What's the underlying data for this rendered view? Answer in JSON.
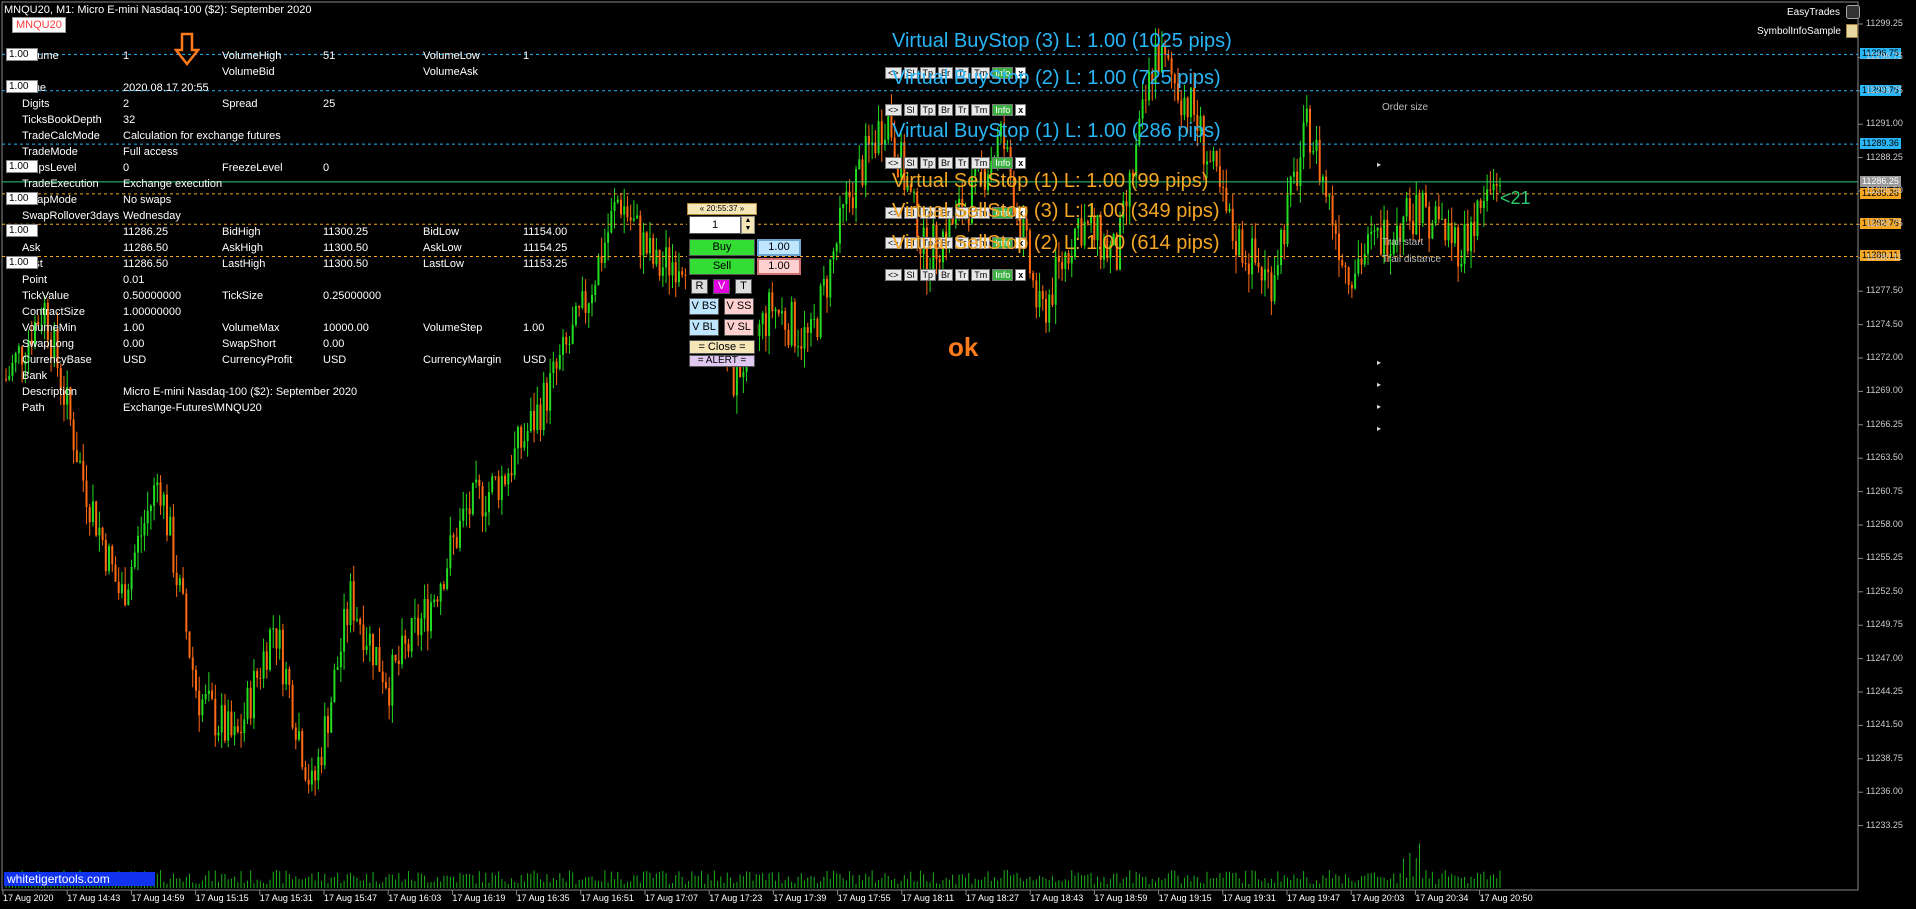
{
  "window": {
    "title": "MNQU20, M1:  Micro E-mini Nasdaq-100 ($2): September 2020",
    "symbol_badge": "MNQU20",
    "top_right_label1": "EasyTrades",
    "top_right_label2": "SymbolInfoSample"
  },
  "lot_default": "1.00",
  "info_rows": [
    {
      "c1": "Volume",
      "v1": "1",
      "c2": "VolumeHigh",
      "v2": "51",
      "c3": "VolumeLow",
      "v3": "1"
    },
    {
      "c1": "",
      "v1": "",
      "c2": "VolumeBid",
      "v2": "",
      "c3": "VolumeAsk",
      "v3": ""
    },
    {
      "c1": "Time",
      "v1": "2020.08.17 20:55",
      "c2": "",
      "v2": "",
      "c3": "",
      "v3": ""
    },
    {
      "c1": "Digits",
      "v1": "2",
      "c2": "Spread",
      "v2": "25",
      "c3": "",
      "v3": ""
    },
    {
      "c1": "TicksBookDepth",
      "v1": "32",
      "c2": "",
      "v2": "",
      "c3": "",
      "v3": ""
    },
    {
      "c1": "TradeCalcMode",
      "v1": "Calculation for exchange futures",
      "c2": "",
      "v2": "",
      "c3": "",
      "v3": ""
    },
    {
      "c1": "TradeMode",
      "v1": "Full access",
      "c2": "",
      "v2": "",
      "c3": "",
      "v3": ""
    },
    {
      "c1": "StopsLevel",
      "v1": "0",
      "c2": "FreezeLevel",
      "v2": "0",
      "c3": "",
      "v3": ""
    },
    {
      "c1": "TradeExecution",
      "v1": "Exchange execution",
      "c2": "",
      "v2": "",
      "c3": "",
      "v3": ""
    },
    {
      "c1": "SwapMode",
      "v1": "No swaps",
      "c2": "",
      "v2": "",
      "c3": "",
      "v3": ""
    },
    {
      "c1": "SwapRollover3days",
      "v1": "Wednesday",
      "c2": "",
      "v2": "",
      "c3": "",
      "v3": ""
    },
    {
      "c1": "Bid",
      "v1": "11286.25",
      "c2": "BidHigh",
      "v2": "11300.25",
      "c3": "BidLow",
      "v3": "11154.00"
    },
    {
      "c1": "Ask",
      "v1": "11286.50",
      "c2": "AskHigh",
      "v2": "11300.50",
      "c3": "AskLow",
      "v3": "11154.25"
    },
    {
      "c1": "Last",
      "v1": "11286.50",
      "c2": "LastHigh",
      "v2": "11300.50",
      "c3": "LastLow",
      "v3": "11153.25"
    },
    {
      "c1": "Point",
      "v1": "0.01",
      "c2": "",
      "v2": "",
      "c3": "",
      "v3": ""
    },
    {
      "c1": "TickValue",
      "v1": "0.50000000",
      "c2": "TickSize",
      "v2": "0.25000000",
      "c3": "",
      "v3": ""
    },
    {
      "c1": "ContractSize",
      "v1": "1.00000000",
      "c2": "",
      "v2": "",
      "c3": "",
      "v3": ""
    },
    {
      "c1": "VolumeMin",
      "v1": "1.00",
      "c2": "VolumeMax",
      "v2": "10000.00",
      "c3": "VolumeStep",
      "v3": "1.00"
    },
    {
      "c1": "SwapLong",
      "v1": "0.00",
      "c2": "SwapShort",
      "v2": "0.00",
      "c3": "",
      "v3": ""
    },
    {
      "c1": "CurrencyBase",
      "v1": "USD",
      "c2": "CurrencyProfit",
      "v2": "USD",
      "c3": "CurrencyMargin",
      "v3": "USD"
    },
    {
      "c1": "Bank",
      "v1": "",
      "c2": "",
      "v2": "",
      "c3": "",
      "v3": ""
    },
    {
      "c1": "Description",
      "v1": "Micro E-mini Nasdaq-100 ($2): September 2020",
      "c2": "",
      "v2": "",
      "c3": "",
      "v3": ""
    },
    {
      "c1": "Path",
      "v1": "Exchange-Futures\\MNQU20",
      "c2": "",
      "v2": "",
      "c3": "",
      "v3": ""
    }
  ],
  "orders": [
    {
      "label": "Virtual BuyStop (3) L: 1.00 (1025 pips)",
      "kind": "buy",
      "price": 11296.75,
      "tag": "11296.75"
    },
    {
      "label": "Virtual BuyStop (2) L: 1.00 (725 pips)",
      "kind": "buy",
      "price": 11293.75,
      "tag": "11293.75"
    },
    {
      "label": "Virtual BuyStop (1) L: 1.00 (286 pips)",
      "kind": "buy",
      "price": 11289.36,
      "tag": "11289.36"
    },
    {
      "label": "Virtual SellStop (1) L: 1.00 (99 pips)",
      "kind": "sell",
      "price": 11285.26,
      "tag": "11285.26"
    },
    {
      "label": "Virtual SellStop (3) L: 1.00 (349 pips)",
      "kind": "sell",
      "price": 11282.76,
      "tag": "11282.76"
    },
    {
      "label": "Virtual SellStop (2) L: 1.00 (614 pips)",
      "kind": "sell",
      "price": 11280.11,
      "tag": "11280.11"
    }
  ],
  "order_buttons": [
    "<>",
    "Sl",
    "Tp",
    "Br",
    "Tr",
    "Tm",
    "Info",
    "x"
  ],
  "panel": {
    "title": "« 20:55:37 »",
    "qty": "1",
    "buy": "Buy",
    "sell": "Sell",
    "buy_lot": "1.00",
    "sell_lot": "1.00",
    "r": "R",
    "v": "V",
    "t": "T",
    "vbs": "V BS",
    "vss": "V SS",
    "vbl": "V BL",
    "vsl": "V SL",
    "close": "= Close =",
    "alert": "= ALERT ="
  },
  "annotations": {
    "ok": "ok",
    "counter": "<21",
    "order_size": "Order size",
    "trail_start": "Trail start",
    "trail_distance": "Trail distance",
    "watermark": "whitetigertools.com"
  },
  "current_price": {
    "price": 11286.25,
    "tag": "11286.25"
  },
  "price_axis": [
    "11299.25",
    "11296.75",
    "11293.75",
    "11291.00",
    "11288.25",
    "11285.50",
    "11282.75",
    "11280.11",
    "11277.50",
    "11274.50",
    "11272.00",
    "11269.00",
    "11266.25",
    "11263.50",
    "11260.75",
    "11258.00",
    "11255.25",
    "11252.50",
    "11249.75",
    "11247.00",
    "11244.25",
    "11241.50",
    "11238.75",
    "11236.00",
    "11233.25"
  ],
  "time_axis": [
    "17 Aug 2020",
    "17 Aug 14:43",
    "17 Aug 14:59",
    "17 Aug 15:15",
    "17 Aug 15:31",
    "17 Aug 15:47",
    "17 Aug 16:03",
    "17 Aug 16:19",
    "17 Aug 16:35",
    "17 Aug 16:51",
    "17 Aug 17:07",
    "17 Aug 17:23",
    "17 Aug 17:39",
    "17 Aug 17:55",
    "17 Aug 18:11",
    "17 Aug 18:27",
    "17 Aug 18:43",
    "17 Aug 18:59",
    "17 Aug 19:15",
    "17 Aug 19:31",
    "17 Aug 19:47",
    "17 Aug 20:03",
    "17 Aug 20:34",
    "17 Aug 20:50"
  ],
  "colors": {
    "bull": "#22dd22",
    "bear": "#ff6a13",
    "buy_line": "#29b6f6",
    "sell_line": "#f5a623",
    "price_line": "#2ecc71"
  },
  "chart_data": {
    "type": "candlestick",
    "price_range": [
      11231.5,
      11300.5
    ],
    "close_path": [
      11270,
      11276,
      11262,
      11252,
      11262,
      11244,
      11240,
      11250,
      11236,
      11252,
      11245,
      11251,
      11259,
      11262,
      11268,
      11275,
      11285,
      11279,
      11281,
      11270,
      11276,
      11273,
      11285,
      11292,
      11280,
      11284,
      11290,
      11275,
      11283,
      11280,
      11297,
      11292,
      11282,
      11278,
      11291,
      11279,
      11282,
      11284,
      11281,
      11287
    ]
  }
}
